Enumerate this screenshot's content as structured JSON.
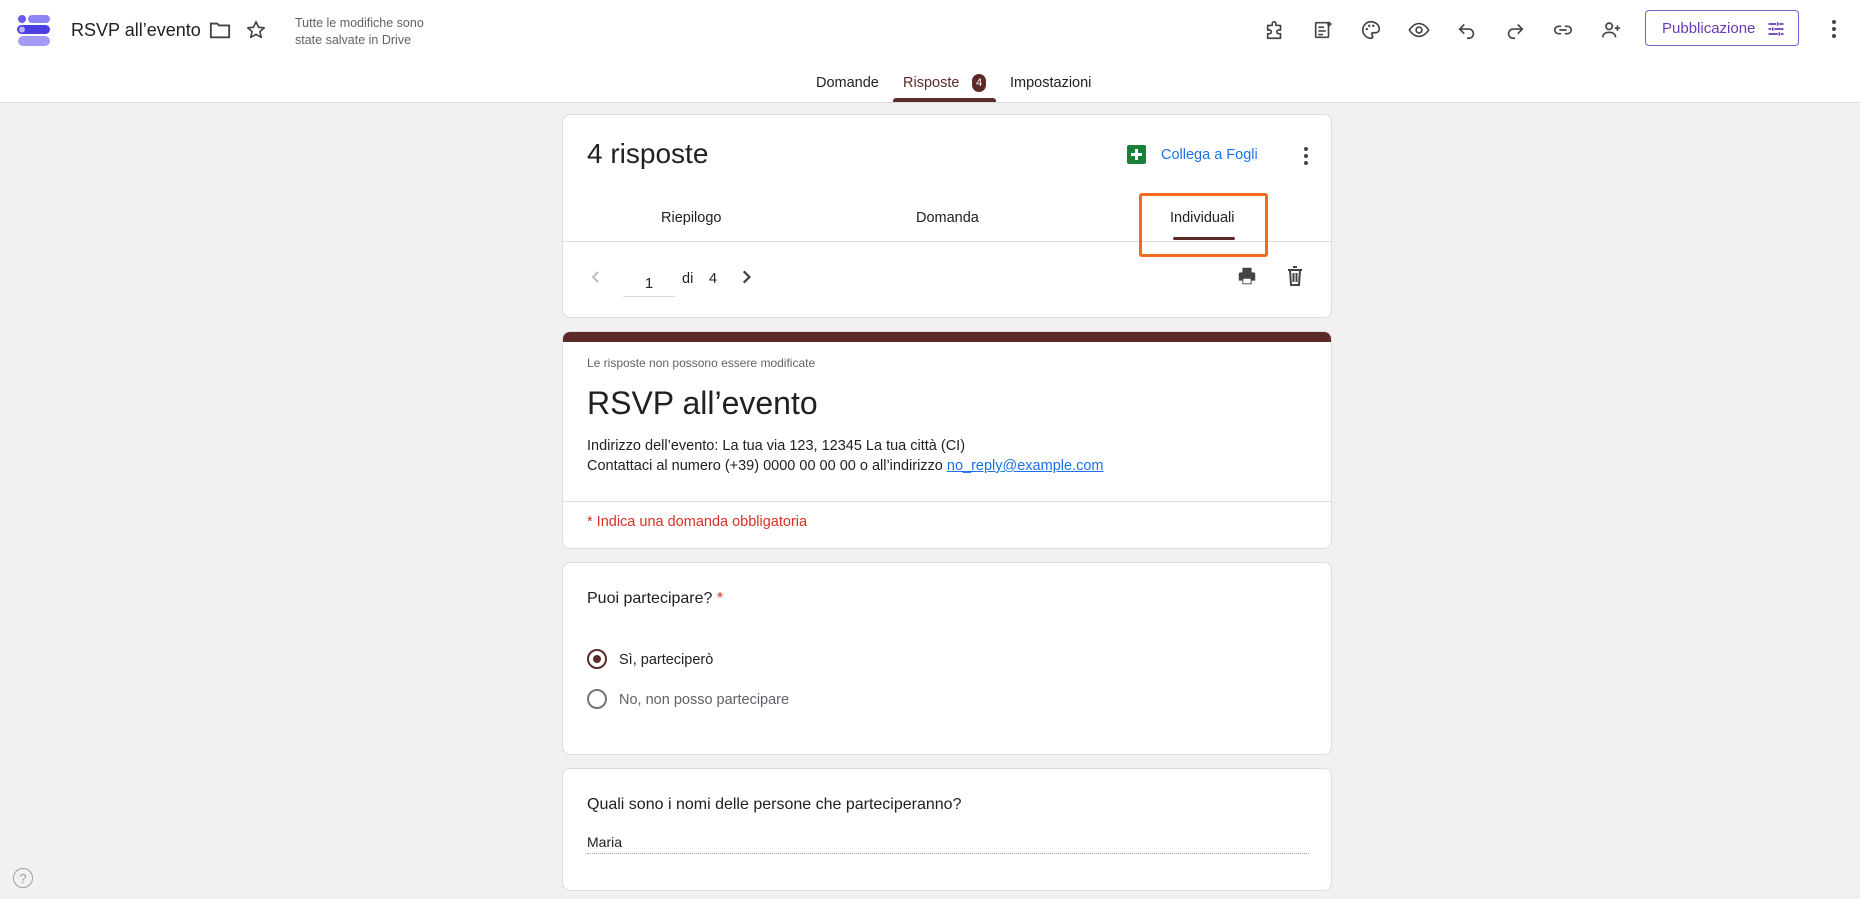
{
  "header": {
    "title": "RSVP all’evento",
    "save_status_line1": "Tutte le modifiche sono",
    "save_status_line2": "state salvate in Drive",
    "icons": [
      "folder-icon",
      "star-icon",
      "addon-icon",
      "customize-icon",
      "palette-icon",
      "preview-icon",
      "undo-icon",
      "redo-icon",
      "link-icon",
      "add-collaborator-icon",
      "tune-icon",
      "more-vert-icon"
    ],
    "publish_label": "Pubblicazione"
  },
  "tabs": {
    "domande": "Domande",
    "risposte": "Risposte",
    "risposte_badge": "4",
    "impostazioni": "Impostazioni",
    "active": "Risposte"
  },
  "responses": {
    "count_title": "4 risposte",
    "link_sheets": "Collega a Fogli",
    "subtabs": {
      "riepilogo": "Riepilogo",
      "domanda": "Domanda",
      "individuali": "Individuali",
      "active": "Individuali"
    },
    "pager": {
      "current": "1",
      "of_label": "di",
      "total": "4"
    }
  },
  "form": {
    "note": "Le risposte non possono essere modificate",
    "title": "RSVP all’evento",
    "desc_line1": "Indirizzo dell’evento: La tua via 123, 12345 La tua città (CI)",
    "desc_line2_prefix": "Contattaci al numero (+39) 0000 00 00 00 o all’indirizzo ",
    "desc_email": "no_reply@example.com",
    "required_note": "* Indica una domanda obbligatoria"
  },
  "questions": {
    "q1": {
      "title": "Puoi partecipare?",
      "required_mark": "*",
      "options": [
        "Sì, parteciperò",
        "No, non posso partecipare"
      ],
      "selected_index": 0
    },
    "q2": {
      "title": "Quali sono i nomi delle persone che parteciperanno?",
      "answer": "Maria"
    }
  },
  "footer": {
    "help_label": "?"
  },
  "colors": {
    "accent": "#5c2b29",
    "publish": "#673ab7",
    "link": "#1a73e8",
    "highlight": "#f26b1d",
    "required": "#d93025"
  }
}
